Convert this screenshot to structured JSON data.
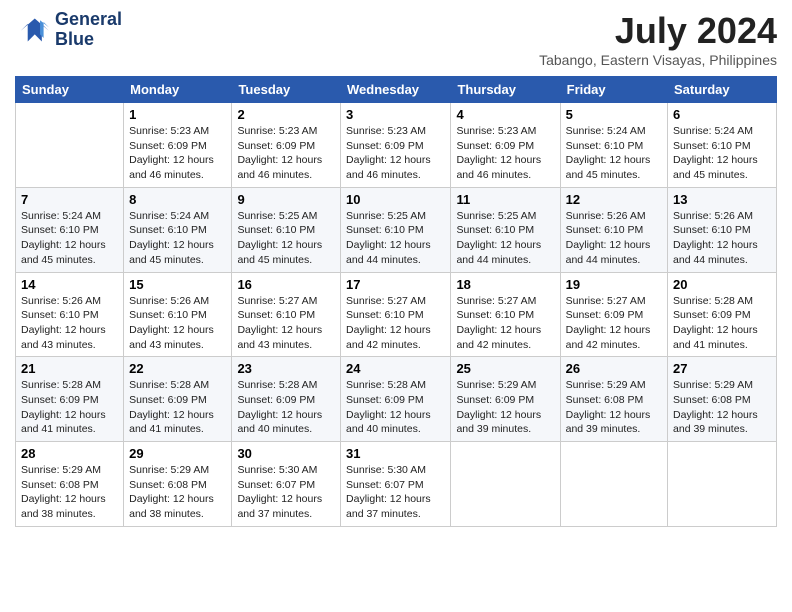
{
  "header": {
    "logo_line1": "General",
    "logo_line2": "Blue",
    "month": "July 2024",
    "location": "Tabango, Eastern Visayas, Philippines"
  },
  "days_of_week": [
    "Sunday",
    "Monday",
    "Tuesday",
    "Wednesday",
    "Thursday",
    "Friday",
    "Saturday"
  ],
  "weeks": [
    [
      {
        "date": "",
        "info": ""
      },
      {
        "date": "1",
        "info": "Sunrise: 5:23 AM\nSunset: 6:09 PM\nDaylight: 12 hours and 46 minutes."
      },
      {
        "date": "2",
        "info": "Sunrise: 5:23 AM\nSunset: 6:09 PM\nDaylight: 12 hours and 46 minutes."
      },
      {
        "date": "3",
        "info": "Sunrise: 5:23 AM\nSunset: 6:09 PM\nDaylight: 12 hours and 46 minutes."
      },
      {
        "date": "4",
        "info": "Sunrise: 5:23 AM\nSunset: 6:09 PM\nDaylight: 12 hours and 46 minutes."
      },
      {
        "date": "5",
        "info": "Sunrise: 5:24 AM\nSunset: 6:10 PM\nDaylight: 12 hours and 45 minutes."
      },
      {
        "date": "6",
        "info": "Sunrise: 5:24 AM\nSunset: 6:10 PM\nDaylight: 12 hours and 45 minutes."
      }
    ],
    [
      {
        "date": "7",
        "info": "Sunrise: 5:24 AM\nSunset: 6:10 PM\nDaylight: 12 hours and 45 minutes."
      },
      {
        "date": "8",
        "info": "Sunrise: 5:24 AM\nSunset: 6:10 PM\nDaylight: 12 hours and 45 minutes."
      },
      {
        "date": "9",
        "info": "Sunrise: 5:25 AM\nSunset: 6:10 PM\nDaylight: 12 hours and 45 minutes."
      },
      {
        "date": "10",
        "info": "Sunrise: 5:25 AM\nSunset: 6:10 PM\nDaylight: 12 hours and 44 minutes."
      },
      {
        "date": "11",
        "info": "Sunrise: 5:25 AM\nSunset: 6:10 PM\nDaylight: 12 hours and 44 minutes."
      },
      {
        "date": "12",
        "info": "Sunrise: 5:26 AM\nSunset: 6:10 PM\nDaylight: 12 hours and 44 minutes."
      },
      {
        "date": "13",
        "info": "Sunrise: 5:26 AM\nSunset: 6:10 PM\nDaylight: 12 hours and 44 minutes."
      }
    ],
    [
      {
        "date": "14",
        "info": "Sunrise: 5:26 AM\nSunset: 6:10 PM\nDaylight: 12 hours and 43 minutes."
      },
      {
        "date": "15",
        "info": "Sunrise: 5:26 AM\nSunset: 6:10 PM\nDaylight: 12 hours and 43 minutes."
      },
      {
        "date": "16",
        "info": "Sunrise: 5:27 AM\nSunset: 6:10 PM\nDaylight: 12 hours and 43 minutes."
      },
      {
        "date": "17",
        "info": "Sunrise: 5:27 AM\nSunset: 6:10 PM\nDaylight: 12 hours and 42 minutes."
      },
      {
        "date": "18",
        "info": "Sunrise: 5:27 AM\nSunset: 6:10 PM\nDaylight: 12 hours and 42 minutes."
      },
      {
        "date": "19",
        "info": "Sunrise: 5:27 AM\nSunset: 6:09 PM\nDaylight: 12 hours and 42 minutes."
      },
      {
        "date": "20",
        "info": "Sunrise: 5:28 AM\nSunset: 6:09 PM\nDaylight: 12 hours and 41 minutes."
      }
    ],
    [
      {
        "date": "21",
        "info": "Sunrise: 5:28 AM\nSunset: 6:09 PM\nDaylight: 12 hours and 41 minutes."
      },
      {
        "date": "22",
        "info": "Sunrise: 5:28 AM\nSunset: 6:09 PM\nDaylight: 12 hours and 41 minutes."
      },
      {
        "date": "23",
        "info": "Sunrise: 5:28 AM\nSunset: 6:09 PM\nDaylight: 12 hours and 40 minutes."
      },
      {
        "date": "24",
        "info": "Sunrise: 5:28 AM\nSunset: 6:09 PM\nDaylight: 12 hours and 40 minutes."
      },
      {
        "date": "25",
        "info": "Sunrise: 5:29 AM\nSunset: 6:09 PM\nDaylight: 12 hours and 39 minutes."
      },
      {
        "date": "26",
        "info": "Sunrise: 5:29 AM\nSunset: 6:08 PM\nDaylight: 12 hours and 39 minutes."
      },
      {
        "date": "27",
        "info": "Sunrise: 5:29 AM\nSunset: 6:08 PM\nDaylight: 12 hours and 39 minutes."
      }
    ],
    [
      {
        "date": "28",
        "info": "Sunrise: 5:29 AM\nSunset: 6:08 PM\nDaylight: 12 hours and 38 minutes."
      },
      {
        "date": "29",
        "info": "Sunrise: 5:29 AM\nSunset: 6:08 PM\nDaylight: 12 hours and 38 minutes."
      },
      {
        "date": "30",
        "info": "Sunrise: 5:30 AM\nSunset: 6:07 PM\nDaylight: 12 hours and 37 minutes."
      },
      {
        "date": "31",
        "info": "Sunrise: 5:30 AM\nSunset: 6:07 PM\nDaylight: 12 hours and 37 minutes."
      },
      {
        "date": "",
        "info": ""
      },
      {
        "date": "",
        "info": ""
      },
      {
        "date": "",
        "info": ""
      }
    ]
  ]
}
